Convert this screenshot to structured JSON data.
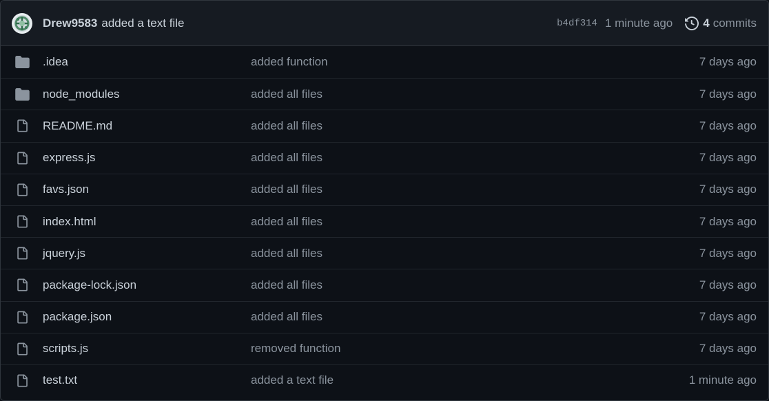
{
  "latest_commit": {
    "author": "Drew9583",
    "message": "added a text file",
    "sha": "b4df314",
    "time": "1 minute ago",
    "commit_count": "4",
    "commits_label": "commits"
  },
  "colors": {
    "background": "#0d1117",
    "header_bg": "#161b22",
    "border": "#30363d",
    "text": "#c9d1d9",
    "muted": "#8b949e",
    "folder_icon": "#8b949e"
  },
  "files": [
    {
      "name": ".idea",
      "type": "folder",
      "icon": "folder-icon",
      "message": "added function",
      "time": "7 days ago"
    },
    {
      "name": "node_modules",
      "type": "folder",
      "icon": "folder-icon",
      "message": "added all files",
      "time": "7 days ago"
    },
    {
      "name": "README.md",
      "type": "file",
      "icon": "file-icon",
      "message": "added all files",
      "time": "7 days ago"
    },
    {
      "name": "express.js",
      "type": "file",
      "icon": "file-icon",
      "message": "added all files",
      "time": "7 days ago"
    },
    {
      "name": "favs.json",
      "type": "file",
      "icon": "file-icon",
      "message": "added all files",
      "time": "7 days ago"
    },
    {
      "name": "index.html",
      "type": "file",
      "icon": "file-icon",
      "message": "added all files",
      "time": "7 days ago"
    },
    {
      "name": "jquery.js",
      "type": "file",
      "icon": "file-icon",
      "message": "added all files",
      "time": "7 days ago"
    },
    {
      "name": "package-lock.json",
      "type": "file",
      "icon": "file-icon",
      "message": "added all files",
      "time": "7 days ago"
    },
    {
      "name": "package.json",
      "type": "file",
      "icon": "file-icon",
      "message": "added all files",
      "time": "7 days ago"
    },
    {
      "name": "scripts.js",
      "type": "file",
      "icon": "file-icon",
      "message": "removed function",
      "time": "7 days ago"
    },
    {
      "name": "test.txt",
      "type": "file",
      "icon": "file-icon",
      "message": "added a text file",
      "time": "1 minute ago"
    }
  ]
}
